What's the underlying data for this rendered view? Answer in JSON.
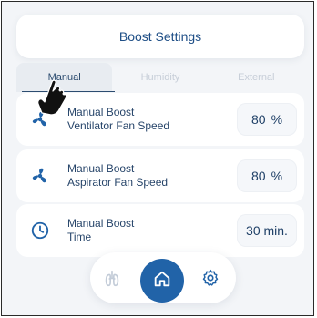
{
  "header": {
    "title": "Boost Settings"
  },
  "tabs": [
    {
      "label": "Manual"
    },
    {
      "label": "Humidity"
    },
    {
      "label": "External"
    }
  ],
  "rows": [
    {
      "icon": "fan-icon",
      "line1": "Manual Boost",
      "line2": "Ventilator Fan Speed",
      "value": "80",
      "unit": "%"
    },
    {
      "icon": "fan-icon",
      "line1": "Manual Boost",
      "line2": "Aspirator Fan Speed",
      "value": "80",
      "unit": "%"
    },
    {
      "icon": "clock-icon",
      "line1": "Manual Boost",
      "line2": "Time",
      "value": "30 min."
    }
  ],
  "nav": {
    "left_icon": "lungs-icon",
    "center_icon": "home-icon",
    "right_icon": "gear-icon"
  },
  "colors": {
    "accent": "#2163a8",
    "text_primary": "#27456a",
    "tab_inactive": "#c7ced8"
  }
}
